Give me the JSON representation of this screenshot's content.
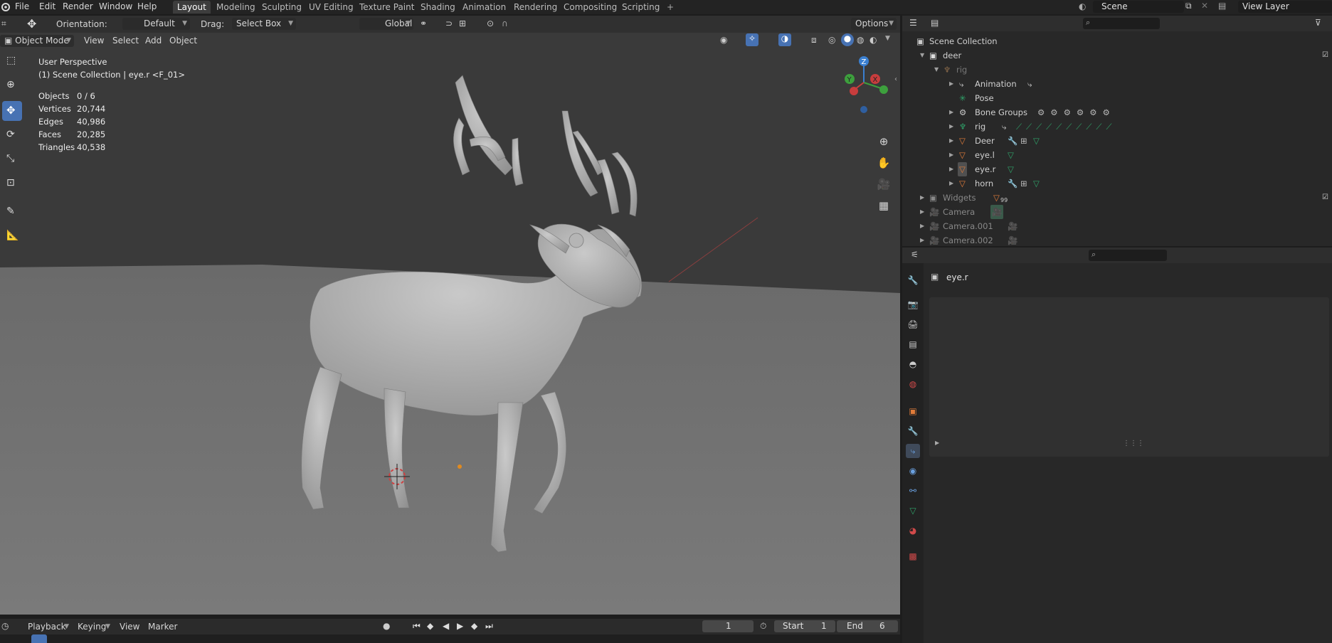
{
  "topbar": {
    "menus": [
      "File",
      "Edit",
      "Render",
      "Window",
      "Help"
    ],
    "workspaces": [
      "Layout",
      "Modeling",
      "Sculpting",
      "UV Editing",
      "Texture Paint",
      "Shading",
      "Animation",
      "Rendering",
      "Compositing",
      "Scripting"
    ],
    "active_workspace": "Layout",
    "add_tab": "+",
    "scene_name": "Scene",
    "view_layer": "View Layer"
  },
  "viewport_header": {
    "orientation_label": "Orientation:",
    "orientation_value": "Default",
    "drag_label": "Drag:",
    "drag_value": "Select Box",
    "transform_orientation": "Global",
    "options_label": "Options",
    "mode": "Object Mode",
    "view_menu": "View",
    "select_menu": "Select",
    "add_menu": "Add",
    "object_menu": "Object"
  },
  "overlay": {
    "perspective": "User Perspective",
    "collection_info": "(1) Scene Collection | eye.r <F_01>",
    "stats": [
      {
        "label": "Objects",
        "value": "0 / 6"
      },
      {
        "label": "Vertices",
        "value": "20,744"
      },
      {
        "label": "Edges",
        "value": "40,986"
      },
      {
        "label": "Faces",
        "value": "20,285"
      },
      {
        "label": "Triangles",
        "value": "40,538"
      }
    ]
  },
  "gizmo": {
    "z": "Z",
    "y": "Y",
    "x": "X"
  },
  "timeline": {
    "playback": "Playback",
    "keying": "Keying",
    "view": "View",
    "marker": "Marker",
    "current_frame": "1",
    "start_label": "Start",
    "start_value": "1",
    "end_label": "End",
    "end_value": "6"
  },
  "outliner": {
    "root": "Scene Collection",
    "items": [
      {
        "name": "deer",
        "type": "collection"
      },
      {
        "name": "rig",
        "type": "armature-faded"
      },
      {
        "name": "Animation",
        "type": "animation"
      },
      {
        "name": "Pose",
        "type": "pose"
      },
      {
        "name": "Bone Groups",
        "type": "bone-groups"
      },
      {
        "name": "rig",
        "type": "armature-data"
      },
      {
        "name": "Deer",
        "type": "mesh"
      },
      {
        "name": "eye.l",
        "type": "mesh"
      },
      {
        "name": "eye.r",
        "type": "mesh"
      },
      {
        "name": "horn",
        "type": "mesh"
      },
      {
        "name": "Widgets",
        "type": "collection-faded"
      },
      {
        "name": "Camera",
        "type": "camera"
      },
      {
        "name": "Camera.001",
        "type": "camera"
      },
      {
        "name": "Camera.002",
        "type": "camera"
      }
    ],
    "widgets_count": "99"
  },
  "properties": {
    "object_name": "eye.r"
  },
  "colors": {
    "accent": "#4772b3",
    "viewport_bg": "#3d3d3d",
    "mesh_orange": "#e07b39",
    "green_icon": "#2fa36a"
  }
}
